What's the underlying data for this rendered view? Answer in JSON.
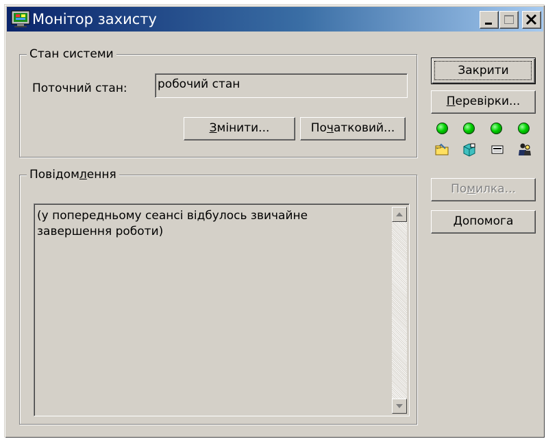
{
  "window": {
    "title": "Монітор захисту",
    "app_icon": "monitor-icon"
  },
  "title_buttons": {
    "minimize": "minimize-icon",
    "maximize": "maximize-icon",
    "close": "close-icon"
  },
  "system_state": {
    "group_label": "Стан системи",
    "current_label": "Поточний стан:",
    "current_value": "робочий стан",
    "change_button": {
      "pre": "",
      "accel": "З",
      "post": "мінити..."
    },
    "initial_button": {
      "pre": "По",
      "accel": "ч",
      "post": "атковий..."
    }
  },
  "messages": {
    "group_label_pre": "Повідом",
    "group_label_accel": "л",
    "group_label_post": "ення",
    "text": "(у попередньому сеансі відбулось звичайне завершення роботи)"
  },
  "side": {
    "close_button": "Закрити",
    "checks_button": {
      "accel": "П",
      "post": "еревірки..."
    },
    "error_button": {
      "pre": "По",
      "accel": "м",
      "post": "илка..."
    },
    "help_button": {
      "accel": "Д",
      "post": "опомога"
    },
    "indicators": [
      {
        "icon": "green-led-icon",
        "status": "ok"
      },
      {
        "icon": "green-led-icon",
        "status": "ok"
      },
      {
        "icon": "green-led-icon",
        "status": "ok"
      },
      {
        "icon": "green-led-icon",
        "status": "ok"
      }
    ],
    "status_icons": [
      "folder-icon",
      "cube-icon",
      "card-icon",
      "users-icon"
    ]
  },
  "colors": {
    "face": "#d4d0c8",
    "title_start": "#0a246a",
    "title_end": "#a6caf0",
    "led": "#00d000"
  }
}
